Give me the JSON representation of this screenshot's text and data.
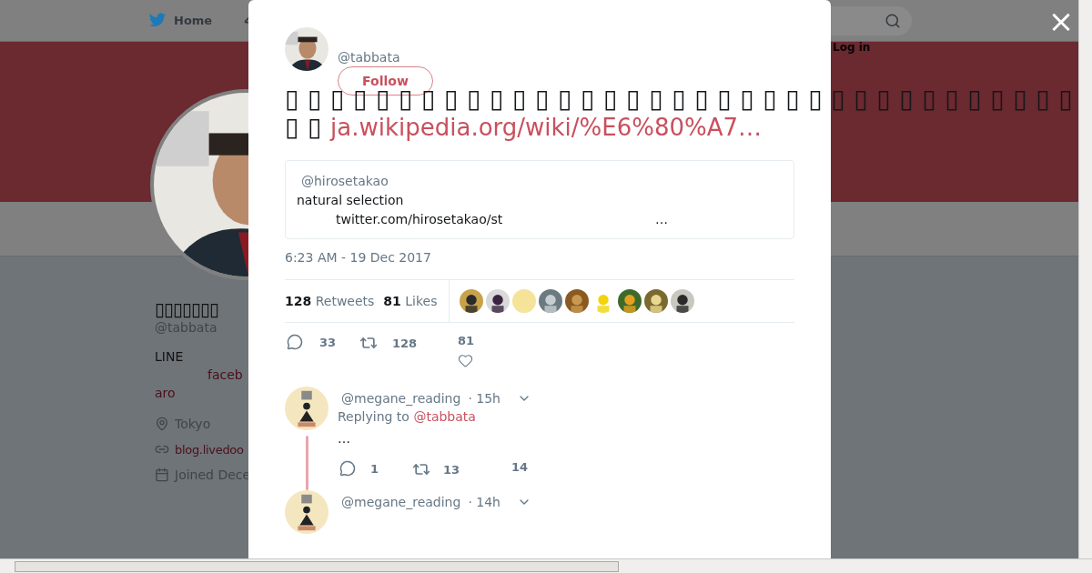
{
  "background_page": {
    "nav": {
      "home": "Home",
      "login": "Log in"
    },
    "profile": {
      "name": "▯▯▯▯▯▯▯",
      "handle": "@tabbata",
      "bio": [
        {
          "kind": "text",
          "text": "LINE"
        },
        {
          "kind": "link",
          "text": "faceb"
        },
        {
          "kind": "link",
          "text": "aro"
        }
      ],
      "location": "Tokyo",
      "website": "blog.livedoo",
      "joined": "Joined Dece"
    }
  },
  "modal": {
    "close": "×",
    "tweet": {
      "handle": "@tabbata",
      "follow": "Follow",
      "text": "▯▯▯▯▯▯▯▯▯▯▯▯▯▯▯▯▯▯▯▯▯▯▯▯▯▯▯▯▯▯▯▯▯▯▯▯▯",
      "link": "ja.wikipedia.org/wiki/%E6%80%A7…",
      "quote": {
        "handle": "@hirosetakao",
        "text": "natural selection",
        "link": "twitter.com/hirosetakao/st",
        "more": "…"
      },
      "time": "6:23 AM - 19 Dec 2017",
      "stats": [
        {
          "count": "128",
          "label": "Retweets"
        },
        {
          "count": "81",
          "label": "Likes"
        }
      ],
      "actions": {
        "replies": "33",
        "retweets": "128",
        "likes": "81"
      }
    },
    "replies": [
      {
        "handle": "@megane_reading",
        "time": "· 15h",
        "replying_label": "Replying to",
        "replying_to": "@tabbata",
        "text": "…",
        "actions": {
          "replies": "1",
          "retweets": "13",
          "likes": "14"
        }
      },
      {
        "handle": "@megane_reading",
        "time": "· 14h"
      }
    ]
  }
}
